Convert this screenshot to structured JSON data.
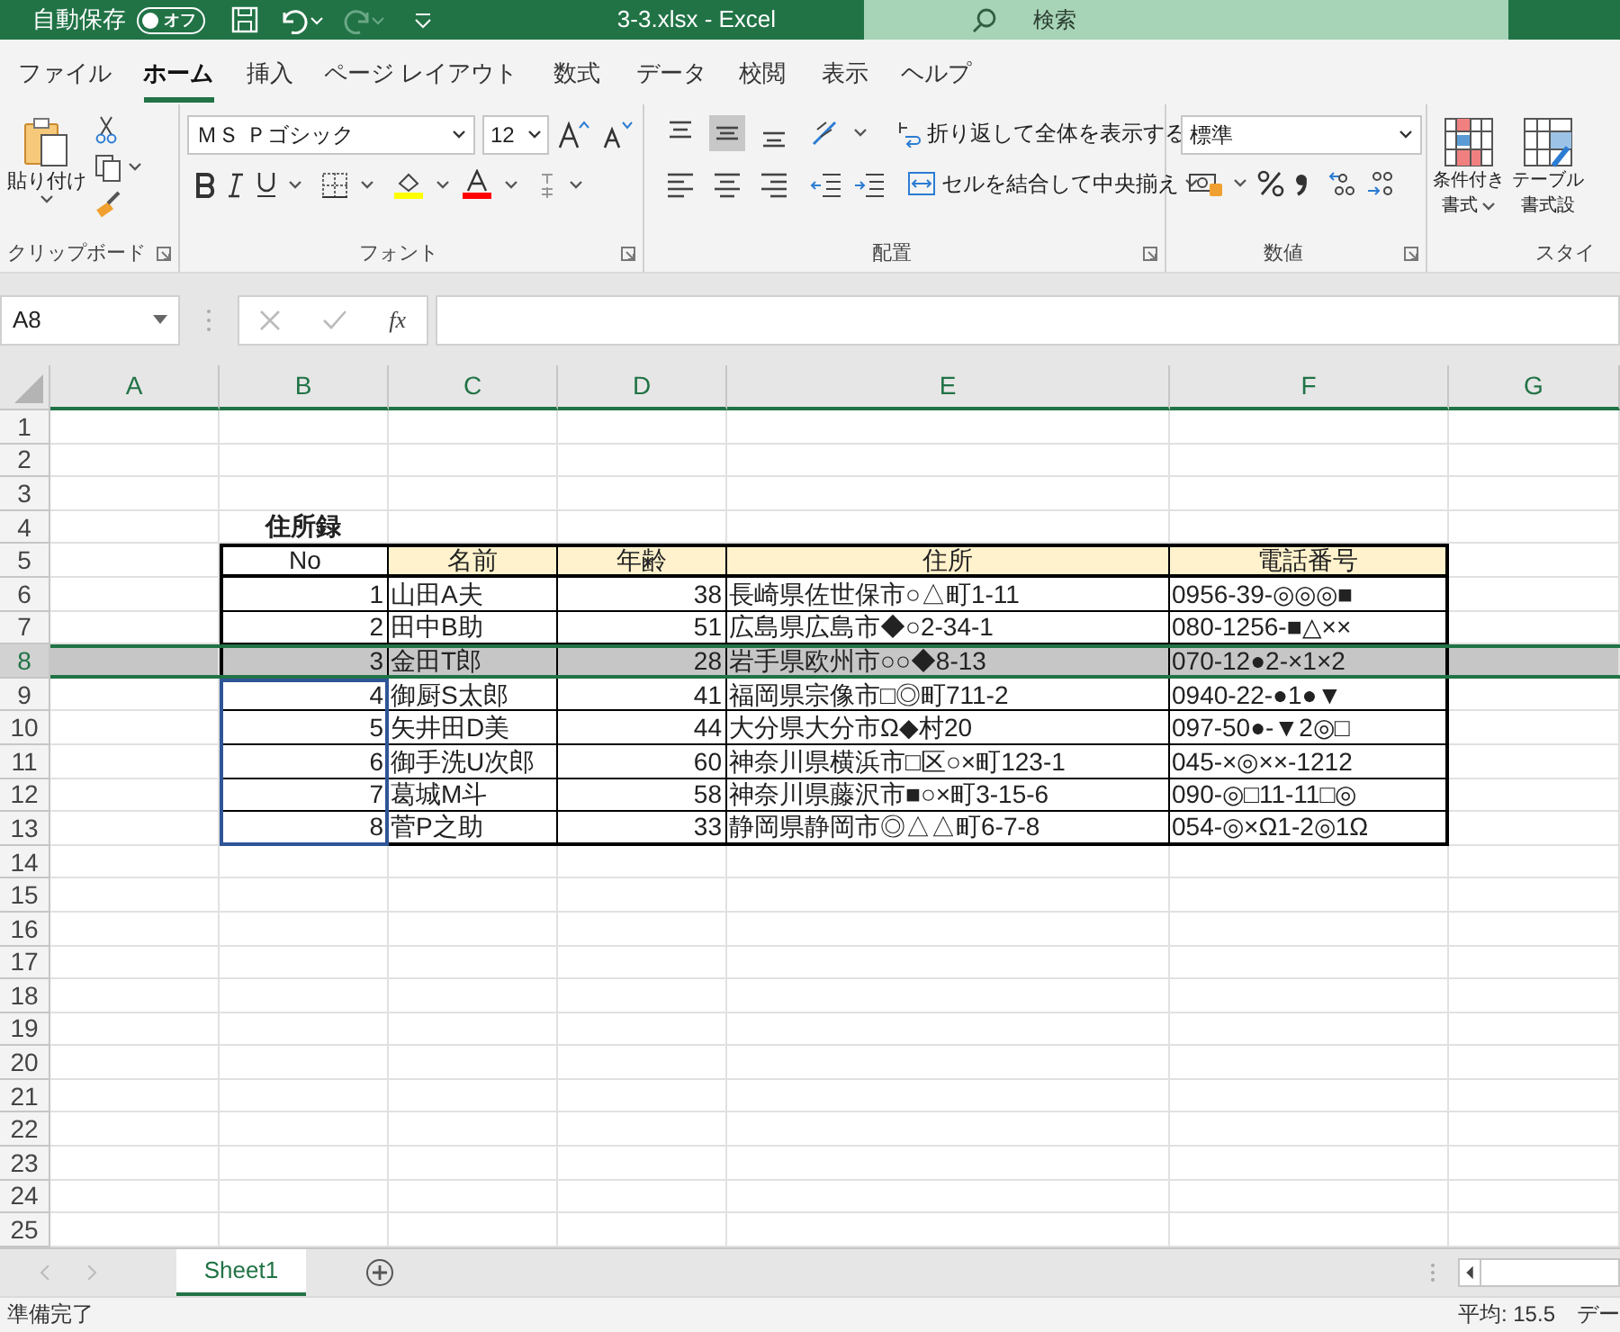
{
  "title_bar": {
    "autosave_label": "自動保存",
    "autosave_state": "オフ",
    "autosave_on": false,
    "title": "3-3.xlsx  -  Excel",
    "search_placeholder": "検索"
  },
  "ribbon_tabs": [
    {
      "label": "ファイル",
      "selected": false
    },
    {
      "label": "ホーム",
      "selected": true
    },
    {
      "label": "挿入",
      "selected": false
    },
    {
      "label": "ページ レイアウト",
      "selected": false
    },
    {
      "label": "数式",
      "selected": false
    },
    {
      "label": "データ",
      "selected": false
    },
    {
      "label": "校閲",
      "selected": false
    },
    {
      "label": "表示",
      "selected": false
    },
    {
      "label": "ヘルプ",
      "selected": false
    }
  ],
  "ribbon": {
    "clipboard": {
      "paste": "貼り付け",
      "group": "クリップボード"
    },
    "font": {
      "family": "ＭＳ Ｐゴシック",
      "size": "12",
      "group": "フォント"
    },
    "alignment": {
      "wrap": "折り返して全体を表示する",
      "merge": "セルを結合して中央揃え",
      "group": "配置"
    },
    "number": {
      "format": "標準",
      "group": "数値"
    },
    "styles": {
      "conditional": [
        "条件付き",
        "書式"
      ],
      "table": [
        "テーブル",
        "書式設"
      ],
      "group": "スタイ"
    }
  },
  "formula_bar": {
    "name_box": "A8",
    "function_label": "fx"
  },
  "sheet": {
    "columns": [
      "A",
      "B",
      "C",
      "D",
      "E",
      "F",
      "G"
    ],
    "row_numbers": [
      "1",
      "2",
      "3",
      "4",
      "5",
      "6",
      "7",
      "8",
      "9",
      "10",
      "11",
      "12",
      "13",
      "14",
      "15",
      "16",
      "17",
      "18",
      "19",
      "20",
      "21",
      "22",
      "23",
      "24",
      "25"
    ],
    "table_title": "住所録",
    "table": {
      "columns": [
        "No",
        "名前",
        "年齢",
        "住所",
        "電話番号"
      ],
      "rows": [
        {
          "cells": [
            "1",
            "山田A夫",
            "38",
            "長崎県佐世保市○△町1-11",
            "0956-39-◎◎◎■"
          ],
          "selected": false,
          "outlined": false
        },
        {
          "cells": [
            "2",
            "田中B助",
            "51",
            "広島県広島市◆○2-34-1",
            "080-1256-■△××"
          ],
          "selected": false,
          "outlined": false
        },
        {
          "cells": [
            "3",
            "金田T郎",
            "28",
            "岩手県欧州市○○◆8-13",
            "070-12●2-×1×2"
          ],
          "selected": true,
          "outlined": false
        },
        {
          "cells": [
            "4",
            "御厨S太郎",
            "41",
            "福岡県宗像市□◎町711-2",
            "0940-22-●1●▼"
          ],
          "selected": false,
          "outlined": true
        },
        {
          "cells": [
            "5",
            "矢井田D美",
            "44",
            "大分県大分市Ω◆村20",
            "097-50●-▼2◎□"
          ],
          "selected": false,
          "outlined": true
        },
        {
          "cells": [
            "6",
            "御手洗U次郎",
            "60",
            "神奈川県横浜市□区○×町123-1",
            "045-×◎××-1212"
          ],
          "selected": false,
          "outlined": true
        },
        {
          "cells": [
            "7",
            "葛城M斗",
            "58",
            "神奈川県藤沢市■○×町3-15-6",
            "090-◎□11-11□◎"
          ],
          "selected": false,
          "outlined": true
        },
        {
          "cells": [
            "8",
            "菅P之助",
            "33",
            "静岡県静岡市◎△△町6-7-8",
            "054-◎×Ω1-2◎1Ω"
          ],
          "selected": false,
          "outlined": true
        }
      ]
    }
  },
  "sheet_tabs": [
    {
      "label": "Sheet1",
      "selected": true
    }
  ],
  "status_bar": {
    "status": "準備完了",
    "average": "平均: 15.5",
    "next": "デー"
  }
}
